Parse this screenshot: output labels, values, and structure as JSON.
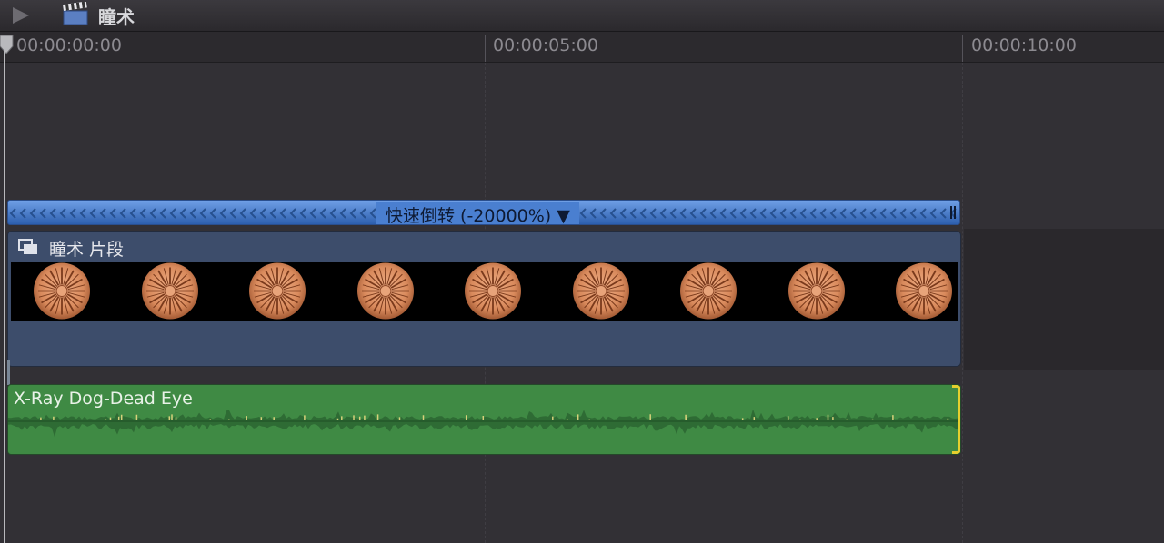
{
  "project": {
    "title": "瞳术"
  },
  "ruler": {
    "marks": [
      "00:00:00:00",
      "00:00:05:00",
      "00:00:10:00"
    ]
  },
  "retime": {
    "label": "快速倒转 (-20000%) ▼"
  },
  "video_clip": {
    "title": "瞳术 片段",
    "thumbnail_count": 9
  },
  "audio_clip": {
    "title": "X-Ray Dog-Dead Eye"
  },
  "colors": {
    "retime_blue": "#3f73c6",
    "video_clip": "#3d4d6b",
    "audio_clip": "#3f8a44",
    "selection_yellow": "#e5cf2e"
  }
}
